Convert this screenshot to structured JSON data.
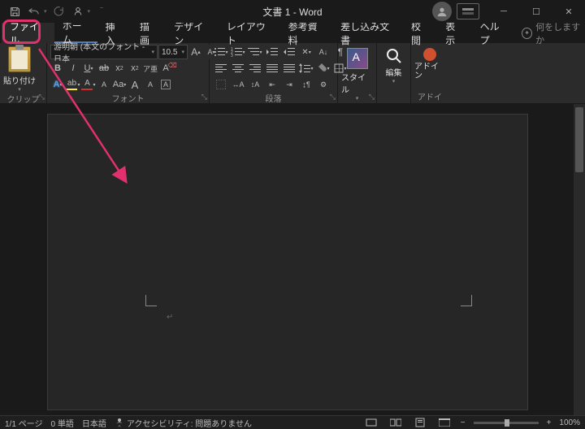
{
  "title": "文書 1 - Word",
  "tabs": {
    "file": "ファイル",
    "home": "ホーム",
    "insert": "挿入",
    "draw": "描画",
    "design": "デザイン",
    "layout": "レイアウト",
    "references": "参考資料",
    "mailings": "差し込み文書",
    "review": "校閲",
    "view": "表示",
    "help": "ヘルプ"
  },
  "tell_me": "何をしますか",
  "ribbon": {
    "clipboard": {
      "label": "クリップボード",
      "paste": "貼り付け"
    },
    "font": {
      "label": "フォント",
      "name": "游明朝 (本文のフォント - 日本",
      "size": "10.5"
    },
    "paragraph": {
      "label": "段落"
    },
    "styles": {
      "label": "スタイル",
      "btn": "スタイル"
    },
    "editing": {
      "label": "編集"
    },
    "addins": {
      "label": "アドイン",
      "btn": "アドイン"
    }
  },
  "status": {
    "page": "1/1 ページ",
    "words": "0 単語",
    "lang": "日本語",
    "accessibility": "アクセシビリティ: 問題ありません",
    "zoom": "100%"
  }
}
